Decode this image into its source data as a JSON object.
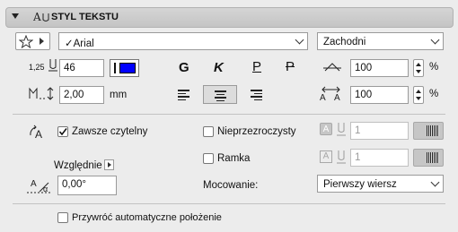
{
  "header": {
    "title": "STYL TEKSTU"
  },
  "font": {
    "name": "Arial",
    "check": "✓",
    "script": "Zachodni"
  },
  "size": {
    "label": "1,25",
    "value": "46"
  },
  "color": {
    "swatch": "#0000ff"
  },
  "styles": {
    "bold": "G",
    "italic": "K",
    "underline": "P",
    "strike": "P"
  },
  "width_factor": {
    "value": "100",
    "unit": "%"
  },
  "spacing": {
    "value": "2,00",
    "unit": "mm"
  },
  "char_spacing": {
    "value": "100",
    "unit": "%"
  },
  "options": {
    "always_readable": "Zawsze czytelny",
    "relative": "Względnie",
    "angle": "0,00°",
    "opaque": "Nieprzezroczysty",
    "frame": "Ramka",
    "anchor_label": "Mocowanie:",
    "anchor_value": "Pierwszy wiersz",
    "fill_value": "1",
    "frame_value": "1"
  },
  "restore": {
    "label": "Przywróć automatyczne położenie"
  }
}
